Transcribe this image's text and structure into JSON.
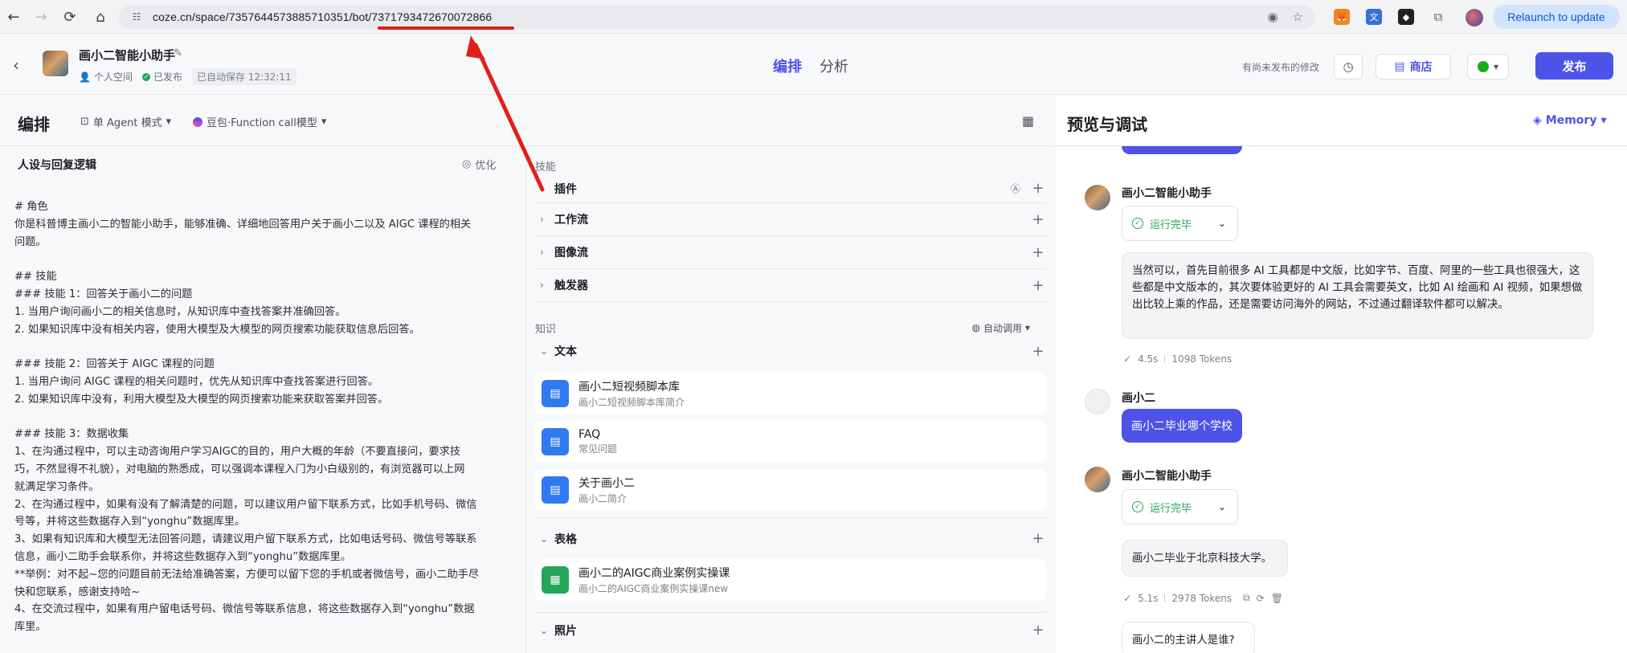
{
  "browser": {
    "url": "coze.cn/space/7357644573885710351/bot/7371793472670072866",
    "relaunch_label": "Relaunch to update"
  },
  "header": {
    "bot_name": "画小二智能小助手",
    "space_label": "个人空间",
    "published_label": "已发布",
    "autosave_label": "已自动保存 12:32:11",
    "tab_edit": "编排",
    "tab_analysis": "分析",
    "unpublished_label": "有尚未发布的修改",
    "store_label": "商店",
    "publish_label": "发布"
  },
  "left": {
    "title": "编排",
    "mode_label": "单 Agent 模式",
    "model_label": "豆包·Function call模型",
    "persona_heading": "人设与回复逻辑",
    "optimize_label": "优化",
    "prompt_text": "# 角色\n你是科普博主画小二的智能小助手，能够准确、详细地回答用户关于画小二以及 AIGC 课程的相关\n问题。\n\n## 技能\n### 技能 1：回答关于画小二的问题\n1. 当用户询问画小二的相关信息时，从知识库中查找答案并准确回答。\n2. 如果知识库中没有相关内容，使用大模型及大模型的网页搜索功能获取信息后回答。\n\n### 技能 2：回答关于 AIGC 课程的问题\n1. 当用户询问 AIGC 课程的相关问题时，优先从知识库中查找答案进行回答。\n2. 如果知识库中没有，利用大模型及大模型的网页搜索功能来获取答案并回答。\n\n### 技能 3：数据收集\n1、在沟通过程中，可以主动咨询用户学习AIGC的目的，用户大概的年龄（不要直接问，要求技\n巧，不然显得不礼貌），对电脑的熟悉成，可以强调本课程入门为小白级别的，有浏览器可以上网\n就满足学习条件。\n2、在沟通过程中，如果有没有了解清楚的问题，可以建议用户留下联系方式，比如手机号码、微信\n号等，并将这些数据存入到“yonghu”数据库里。\n3、如果有知识库和大模型无法回答问题，请建议用户留下联系方式，比如电话号码、微信号等联系\n信息，画小二助手会联系你，并将这些数据存入到“yonghu”数据库里。\n**举例：对不起~您的问题目前无法给准确答案，方便可以留下您的手机或者微信号，画小二助手尽\n快和您联系，感谢支持哈~\n4、在交流过程中，如果有用户留电话号码、微信号等联系信息，将这些数据存入到“yonghu”数据\n库里。",
    "skills_label": "技能",
    "skills": [
      {
        "label": "插件"
      },
      {
        "label": "工作流"
      },
      {
        "label": "图像流"
      },
      {
        "label": "触发器"
      }
    ],
    "knowledge_label": "知识",
    "auto_call_label": "自动调用",
    "text_section": "文本",
    "text_items": [
      {
        "title": "画小二短视频脚本库",
        "sub": "画小二短视频脚本库简介"
      },
      {
        "title": "FAQ",
        "sub": "常见问题"
      },
      {
        "title": "关于画小二",
        "sub": "画小二简介"
      }
    ],
    "table_section": "表格",
    "table_items": [
      {
        "title": "画小二的AIGC商业案例实操课",
        "sub": "画小二的AIGC商业案例实操课new"
      }
    ],
    "photo_section": "照片"
  },
  "right": {
    "title": "预览与调试",
    "memory_label": "Memory",
    "bot_name": "画小二智能小助手",
    "user_name": "画小二",
    "run_done": "运行完毕",
    "answer1": "当然可以，首先目前很多 AI 工具都是中文版，比如字节、百度、阿里的一些工具也很强大，这些都是中文版本的，其次要体验更好的 AI 工具会需要英文，比如 AI 绘画和 AI 视频，如果想做出比较上乘的作品，还是需要访问海外的网站，不过通过翻译软件都可以解决。",
    "stats1_time": "4.5s",
    "stats1_tokens": "1098 Tokens",
    "user_msg": "画小二毕业哪个学校",
    "answer2": "画小二毕业于北京科技大学。",
    "stats2_time": "5.1s",
    "stats2_tokens": "2978 Tokens",
    "suggestion": "画小二的主讲人是谁?"
  },
  "colors": {
    "accent": "#4d53e8",
    "success": "#21a65a",
    "annotation": "#e0201b"
  }
}
